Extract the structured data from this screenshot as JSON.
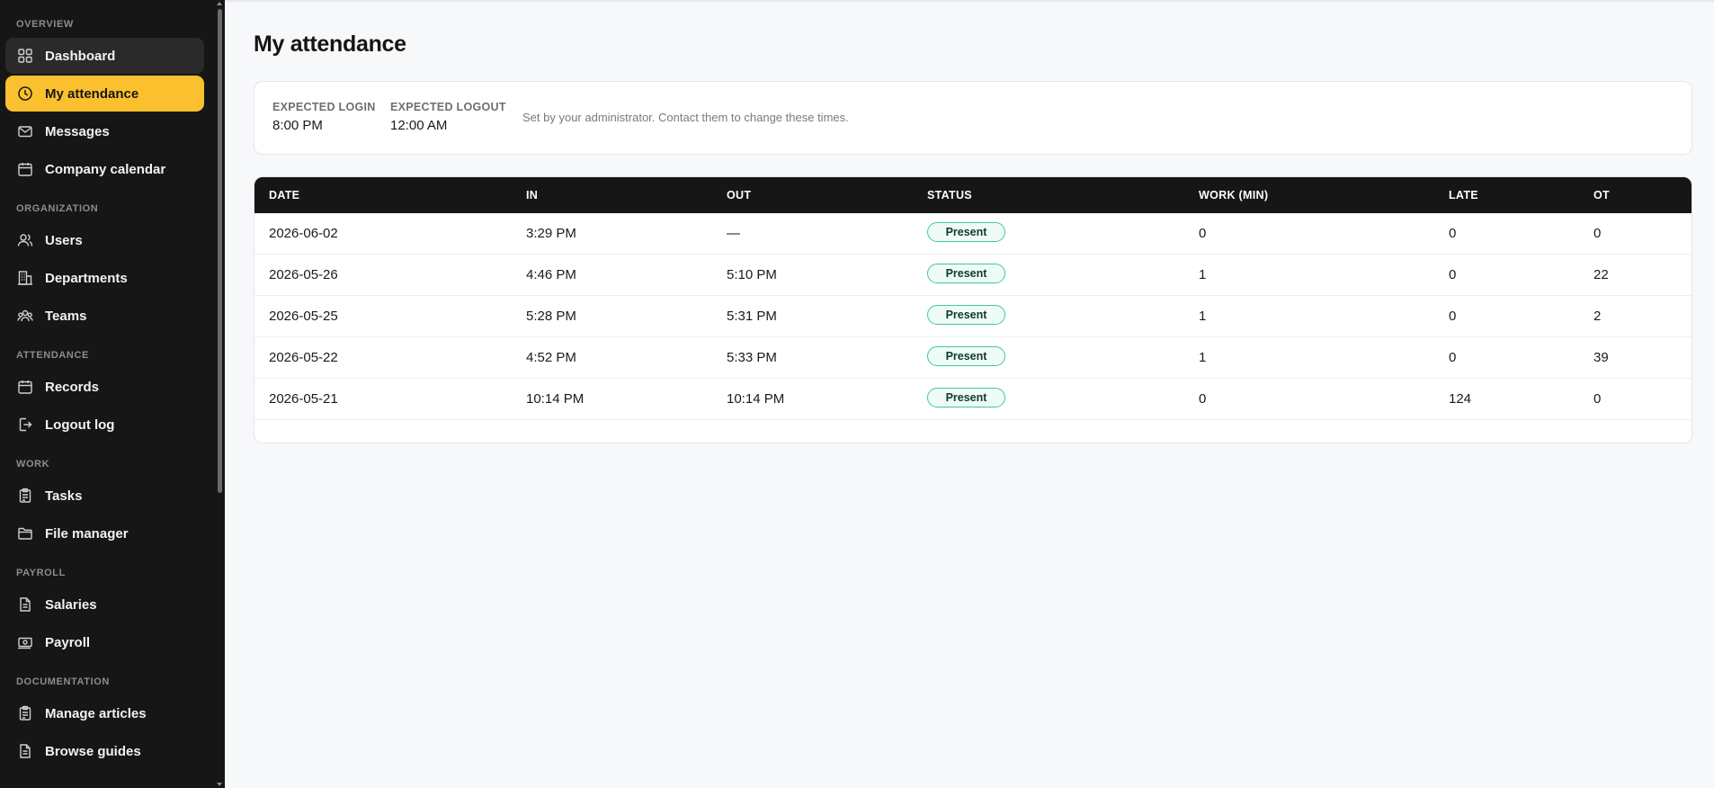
{
  "sidebar": {
    "sections": [
      {
        "label": "OVERVIEW",
        "items": [
          {
            "label": "Dashboard",
            "icon": "grid-icon"
          },
          {
            "label": "My attendance",
            "icon": "clock-icon"
          },
          {
            "label": "Messages",
            "icon": "mail-icon"
          },
          {
            "label": "Company calendar",
            "icon": "calendar-icon"
          }
        ]
      },
      {
        "label": "ORGANIZATION",
        "items": [
          {
            "label": "Users",
            "icon": "users-icon"
          },
          {
            "label": "Departments",
            "icon": "building-icon"
          },
          {
            "label": "Teams",
            "icon": "team-icon"
          }
        ]
      },
      {
        "label": "ATTENDANCE",
        "items": [
          {
            "label": "Records",
            "icon": "calendar-icon"
          },
          {
            "label": "Logout log",
            "icon": "logout-icon"
          }
        ]
      },
      {
        "label": "WORK",
        "items": [
          {
            "label": "Tasks",
            "icon": "clipboard-icon"
          },
          {
            "label": "File manager",
            "icon": "folder-icon"
          }
        ]
      },
      {
        "label": "PAYROLL",
        "items": [
          {
            "label": "Salaries",
            "icon": "document-icon"
          },
          {
            "label": "Payroll",
            "icon": "money-icon"
          }
        ]
      },
      {
        "label": "DOCUMENTATION",
        "items": [
          {
            "label": "Manage articles",
            "icon": "clipboard-icon"
          },
          {
            "label": "Browse guides",
            "icon": "document-icon"
          }
        ]
      }
    ],
    "active_item": "My attendance",
    "hovered_item": "Dashboard",
    "accent_color": "#fbc02d",
    "background_color": "#161616"
  },
  "page": {
    "title": "My attendance"
  },
  "expected": {
    "login_label": "EXPECTED LOGIN",
    "login_value": "8:00 PM",
    "logout_label": "EXPECTED LOGOUT",
    "logout_value": "12:00 AM",
    "note": "Set by your administrator. Contact them to change these times."
  },
  "table": {
    "columns": [
      "DATE",
      "IN",
      "OUT",
      "STATUS",
      "WORK (MIN)",
      "LATE",
      "OT"
    ],
    "rows": [
      {
        "date": "2026-06-02",
        "in": "3:29 PM",
        "out": "—",
        "status": "Present",
        "work": "0",
        "late": "0",
        "ot": "0"
      },
      {
        "date": "2026-05-26",
        "in": "4:46 PM",
        "out": "5:10 PM",
        "status": "Present",
        "work": "1",
        "late": "0",
        "ot": "22"
      },
      {
        "date": "2026-05-25",
        "in": "5:28 PM",
        "out": "5:31 PM",
        "status": "Present",
        "work": "1",
        "late": "0",
        "ot": "2"
      },
      {
        "date": "2026-05-22",
        "in": "4:52 PM",
        "out": "5:33 PM",
        "status": "Present",
        "work": "1",
        "late": "0",
        "ot": "39"
      },
      {
        "date": "2026-05-21",
        "in": "10:14 PM",
        "out": "10:14 PM",
        "status": "Present",
        "work": "0",
        "late": "124",
        "ot": "0"
      }
    ],
    "status_color": "#3ec99a"
  }
}
